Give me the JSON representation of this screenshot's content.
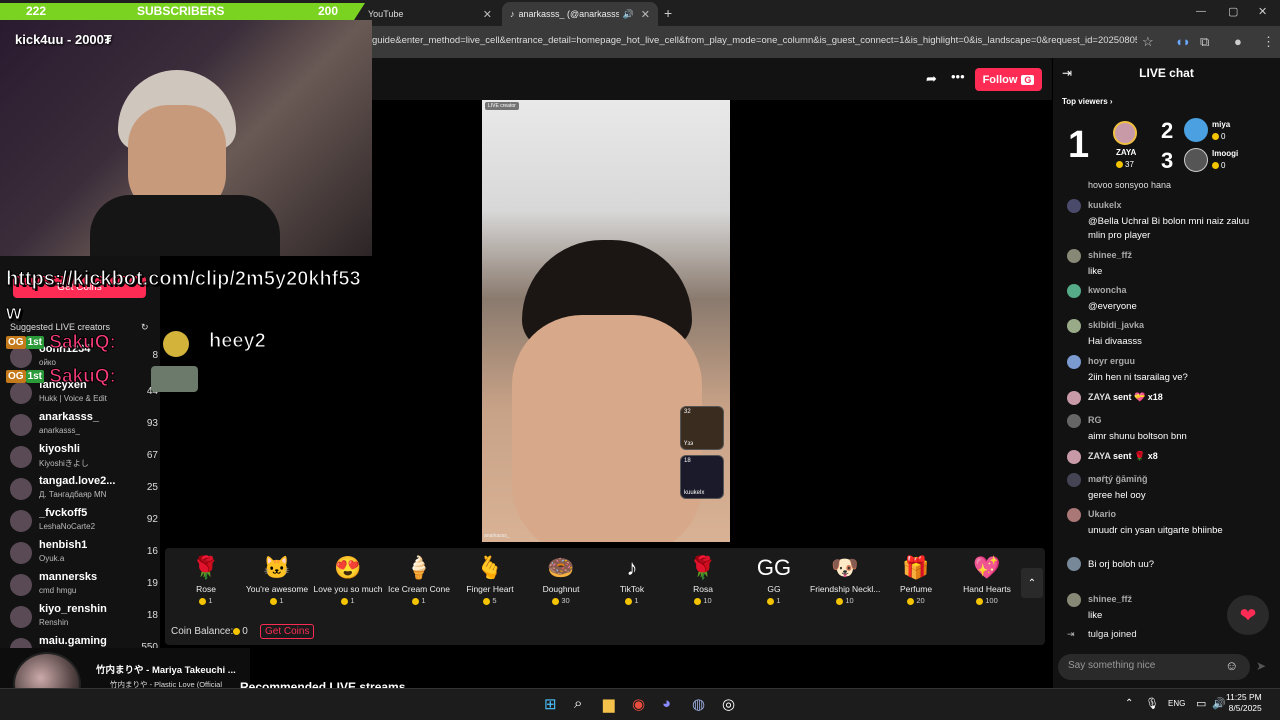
{
  "browser": {
    "tabs": [
      {
        "label": "YouTube"
      },
      {
        "label": "anarkasss_ (@anarkasss_) i..."
      }
    ],
    "url": "guide&enter_method=live_cell&entrance_detail=homepage_hot_live_cell&from_play_mode=one_column&is_guest_connect=1&is_highlight=0&is_landscape=0&request_id=20250805..."
  },
  "overlay": {
    "sub_left": "222",
    "sub_label": "SUBSCRIBERS",
    "sub_right": "200",
    "cam_name": "kick4uu - 2000₮",
    "clip_link": "https://kickbot.com/clip/2m5y20khf53w",
    "chat1_name": "SakuQ:",
    "chat1_msg": "heey2",
    "chat2_name": "SakuQ:",
    "badge1": "OG",
    "badge2": "1st"
  },
  "page": {
    "follow_label": "Follow",
    "follow_key": "G",
    "get_coins": "Get Coins",
    "suggested_title": "Suggested LIVE creators",
    "recommended": "Recommended LIVE streams",
    "live_tag": "LIVE creator",
    "video_user": "anarkasss_"
  },
  "creators": [
    {
      "name": "oonh1234",
      "sub": "ойко",
      "count": "8"
    },
    {
      "name": "fancyxen",
      "sub": "Hukk | Voice & Edit",
      "count": "44"
    },
    {
      "name": "anarkasss_",
      "sub": "anarkasss_",
      "count": "93"
    },
    {
      "name": "kiyoshli",
      "sub": "Kiyoshiきよし",
      "count": "67"
    },
    {
      "name": "tangad.love2...",
      "sub": "Д. Тангадбаяр MN",
      "count": "25"
    },
    {
      "name": "_fvckoff5",
      "sub": "LeshaNoCarte2",
      "count": "92"
    },
    {
      "name": "henbish1",
      "sub": "Oyuk.a",
      "count": "16"
    },
    {
      "name": "mannersks",
      "sub": "cmd hmgu",
      "count": "19"
    },
    {
      "name": "kiyo_renshin",
      "sub": "Renshin",
      "count": "18"
    },
    {
      "name": "maiu.gaming",
      "sub": "",
      "count": "550"
    }
  ],
  "gifts": [
    {
      "name": "Rose",
      "price": "1",
      "icon": "🌹"
    },
    {
      "name": "You're awesome",
      "price": "1",
      "icon": "🐱"
    },
    {
      "name": "Love you so much",
      "price": "1",
      "icon": "😍"
    },
    {
      "name": "Ice Cream Cone",
      "price": "1",
      "icon": "🍦"
    },
    {
      "name": "Finger Heart",
      "price": "5",
      "icon": "🫰"
    },
    {
      "name": "Doughnut",
      "price": "30",
      "icon": "🍩"
    },
    {
      "name": "TikTok",
      "price": "1",
      "icon": "♪"
    },
    {
      "name": "Rosa",
      "price": "10",
      "icon": "🌹"
    },
    {
      "name": "GG",
      "price": "1",
      "icon": "GG"
    },
    {
      "name": "Friendship Neckl...",
      "price": "10",
      "icon": "🐶"
    },
    {
      "name": "Perfume",
      "price": "20",
      "icon": "🎁"
    },
    {
      "name": "Hand Hearts",
      "price": "100",
      "icon": "💖"
    }
  ],
  "coin_balance_label": "Coin Balance:",
  "coin_balance": "0",
  "guests": [
    {
      "count": "32",
      "name": "Үзэ"
    },
    {
      "count": "18",
      "name": "kuukelx"
    }
  ],
  "chat": {
    "title": "LIVE chat",
    "top_viewers_label": "Top viewers",
    "top": [
      {
        "rank": "1",
        "name": "ZAYA",
        "coins": "37"
      },
      {
        "rank": "2",
        "name": "miya",
        "coins": "0"
      },
      {
        "rank": "3",
        "name": "lmoogi",
        "coins": "0"
      }
    ],
    "truncated_top": "hovoo sonsyoo hana",
    "messages": [
      {
        "user": "kuukelx",
        "text": "@Bella Uchral Bi bolon mni naiz zaluu mlin pro player"
      },
      {
        "user": "shinee_ffž",
        "text": "like"
      },
      {
        "user": "kwoncha",
        "text": "@everyone"
      },
      {
        "user": "skibidi_javka",
        "text": "Hai divaasss"
      },
      {
        "user": "hoyr erguu",
        "text": "2iin hen ni tsarailag ve?"
      },
      {
        "user": "ZAYA",
        "text": "sent 💝 x18"
      },
      {
        "user": "RG",
        "text": "aimr shunu boltson bnn"
      },
      {
        "user": "ZAYA",
        "text": "sent 🌹 x8"
      },
      {
        "user": "møŕţý ğāmīńğ",
        "text": "geree hel ooy"
      },
      {
        "user": "Ukario",
        "text": "unuudr cin ysan uitgarte bhiinbe"
      },
      {
        "user": "",
        "text": "Bi orj boloh uu?"
      },
      {
        "user": "shinee_ffž",
        "text": "like"
      }
    ],
    "joined_user": "tulga",
    "joined_text": "joined",
    "input_placeholder": "Say something nice"
  },
  "music": {
    "title": "竹内まりや - Mariya Takeuchi ...",
    "subtitle": "竹内まりや - Plastic Love (Official Music Video)"
  },
  "taskbar": {
    "lang": "ENG",
    "time": "11:25 PM",
    "date": "8/5/2025"
  }
}
